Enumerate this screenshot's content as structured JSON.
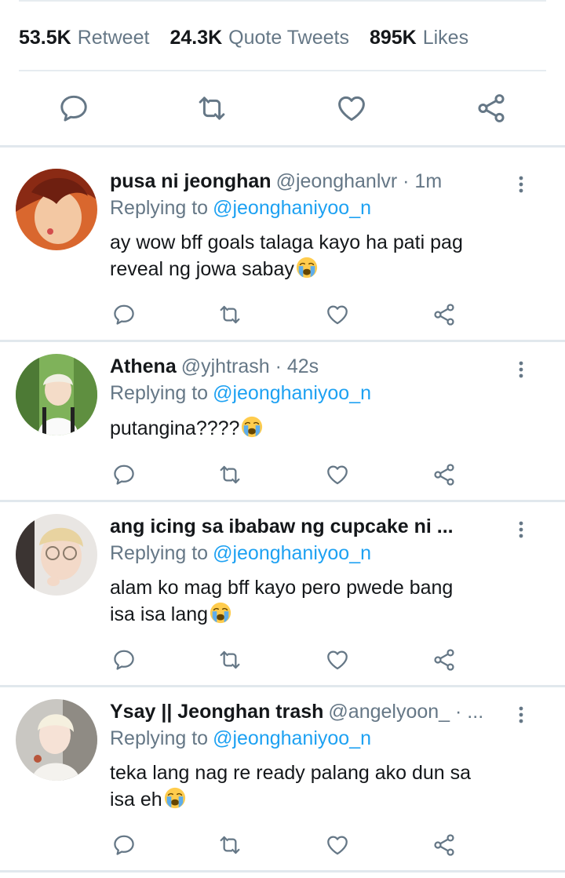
{
  "stats": {
    "retweets_count": "53.5K",
    "retweets_label": "Retweet",
    "quotes_count": "24.3K",
    "quotes_label": "Quote Tweets",
    "likes_count": "895K",
    "likes_label": "Likes"
  },
  "icons": {
    "reply": "comment-icon",
    "retweet": "retweet-icon",
    "like": "heart-icon",
    "share": "share-icon",
    "more": "more-vertical-icon",
    "emoji": "loudly-crying-face-emoji"
  },
  "colors": {
    "text": "#14171a",
    "muted": "#657786",
    "link": "#1da1f2",
    "divider": "#e6ecf0",
    "icon": "#657786"
  },
  "replies": [
    {
      "name": "pusa ni jeonghan",
      "handle": "@jeonghanlvr · 1m",
      "replying_label": "Replying to",
      "replying_to": "@jeonghaniyoo_n",
      "text_line1": "ay wow bff goals talaga kayo ha pati pag",
      "text_line2": "reveal ng jowa sabay"
    },
    {
      "name": "Athena",
      "handle": "@yjhtrash · 42s",
      "replying_label": "Replying to",
      "replying_to": "@jeonghaniyoo_n",
      "text_line1": "putangina????",
      "text_line2": ""
    },
    {
      "name": "ang icing sa ibabaw ng cupcake ni ...",
      "handle": "",
      "replying_label": "Replying to",
      "replying_to": "@jeonghaniyoo_n",
      "text_line1": "alam ko mag bff kayo pero pwede bang",
      "text_line2": "isa isa lang"
    },
    {
      "name": "Ysay || Jeonghan trash",
      "handle": "@angelyoon_ · ...",
      "replying_label": "Replying to",
      "replying_to": "@jeonghaniyoo_n",
      "text_line1": "teka lang nag re ready palang ako dun sa",
      "text_line2": "isa eh"
    }
  ]
}
